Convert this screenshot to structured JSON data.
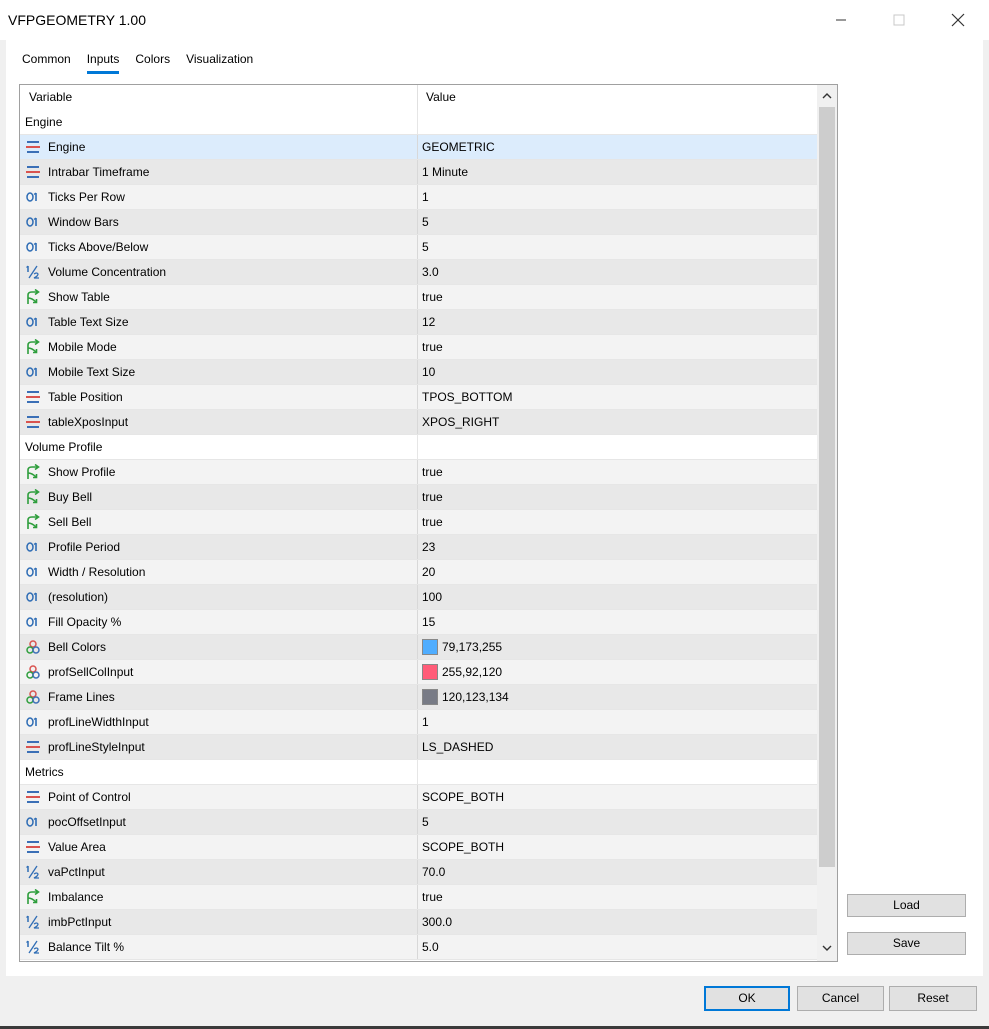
{
  "window": {
    "title": "VFPGEOMETRY 1.00"
  },
  "tabs": [
    {
      "label": "Common",
      "active": false
    },
    {
      "label": "Inputs",
      "active": true
    },
    {
      "label": "Colors",
      "active": false
    },
    {
      "label": "Visualization",
      "active": false
    }
  ],
  "grid": {
    "col_variable": "Variable",
    "col_value": "Value",
    "rows": [
      {
        "kind": "group",
        "label": "Engine"
      },
      {
        "kind": "param",
        "icon": "enum",
        "label": "Engine",
        "value": "GEOMETRIC",
        "selected": true
      },
      {
        "kind": "param",
        "icon": "enum",
        "label": "Intrabar Timeframe",
        "value": "1 Minute"
      },
      {
        "kind": "param",
        "icon": "int",
        "label": "Ticks Per Row",
        "value": "1"
      },
      {
        "kind": "param",
        "icon": "int",
        "label": "Window Bars",
        "value": "5"
      },
      {
        "kind": "param",
        "icon": "int",
        "label": "Ticks Above/Below",
        "value": "5"
      },
      {
        "kind": "param",
        "icon": "double",
        "label": "Volume Concentration",
        "value": "3.0"
      },
      {
        "kind": "param",
        "icon": "bool",
        "label": "Show Table",
        "value": "true"
      },
      {
        "kind": "param",
        "icon": "int",
        "label": "Table Text Size",
        "value": "12"
      },
      {
        "kind": "param",
        "icon": "bool",
        "label": "Mobile Mode",
        "value": "true"
      },
      {
        "kind": "param",
        "icon": "int",
        "label": "Mobile Text Size",
        "value": "10"
      },
      {
        "kind": "param",
        "icon": "enum",
        "label": "Table Position",
        "value": "TPOS_BOTTOM"
      },
      {
        "kind": "param",
        "icon": "enum",
        "label": "tableXposInput",
        "value": "XPOS_RIGHT"
      },
      {
        "kind": "group",
        "label": "Volume Profile"
      },
      {
        "kind": "param",
        "icon": "bool",
        "label": "Show Profile",
        "value": "true"
      },
      {
        "kind": "param",
        "icon": "bool",
        "label": "Buy Bell",
        "value": "true"
      },
      {
        "kind": "param",
        "icon": "bool",
        "label": "Sell Bell",
        "value": "true"
      },
      {
        "kind": "param",
        "icon": "int",
        "label": "Profile Period",
        "value": "23"
      },
      {
        "kind": "param",
        "icon": "int",
        "label": "Width / Resolution",
        "value": "20"
      },
      {
        "kind": "param",
        "icon": "int",
        "label": "(resolution)",
        "value": "100"
      },
      {
        "kind": "param",
        "icon": "int",
        "label": "Fill Opacity %",
        "value": "15"
      },
      {
        "kind": "param",
        "icon": "color",
        "label": "Bell Colors",
        "value": "79,173,255",
        "swatch": "#4fadff"
      },
      {
        "kind": "param",
        "icon": "color",
        "label": "profSellColInput",
        "value": "255,92,120",
        "swatch": "#ff5c78"
      },
      {
        "kind": "param",
        "icon": "color",
        "label": "Frame Lines",
        "value": "120,123,134",
        "swatch": "#787b86"
      },
      {
        "kind": "param",
        "icon": "int",
        "label": "profLineWidthInput",
        "value": "1"
      },
      {
        "kind": "param",
        "icon": "enum",
        "label": "profLineStyleInput",
        "value": "LS_DASHED"
      },
      {
        "kind": "group",
        "label": "Metrics"
      },
      {
        "kind": "param",
        "icon": "enum",
        "label": "Point of Control",
        "value": "SCOPE_BOTH"
      },
      {
        "kind": "param",
        "icon": "int",
        "label": "pocOffsetInput",
        "value": "5"
      },
      {
        "kind": "param",
        "icon": "enum",
        "label": "Value Area",
        "value": "SCOPE_BOTH"
      },
      {
        "kind": "param",
        "icon": "double",
        "label": "vaPctInput",
        "value": "70.0"
      },
      {
        "kind": "param",
        "icon": "bool",
        "label": "Imbalance",
        "value": "true"
      },
      {
        "kind": "param",
        "icon": "double",
        "label": "imbPctInput",
        "value": "300.0"
      },
      {
        "kind": "param",
        "icon": "double",
        "label": "Balance Tilt %",
        "value": "5.0"
      }
    ]
  },
  "side_buttons": {
    "load": "Load",
    "save": "Save"
  },
  "footer": {
    "ok": "OK",
    "cancel": "Cancel",
    "reset": "Reset"
  },
  "colors": {
    "accent": "#0078d7",
    "enum_icon": "#3b6fb6",
    "int_icon": "#2f6db5",
    "bool_icon": "#2e9e3c"
  }
}
